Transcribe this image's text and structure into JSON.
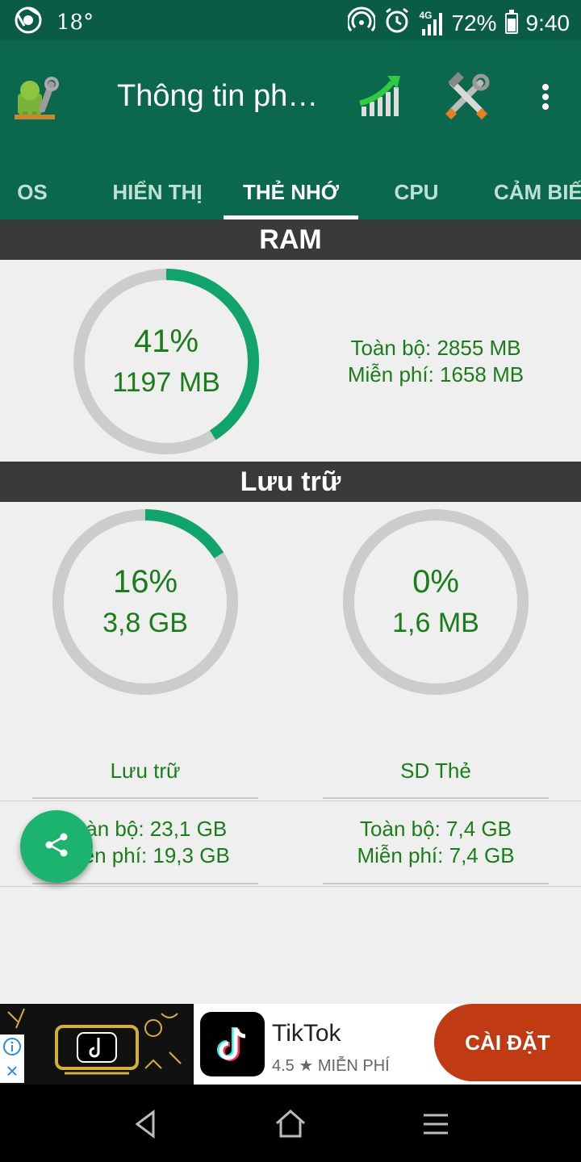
{
  "status_bar": {
    "temperature": "18°",
    "battery": "72%",
    "time": "9:40",
    "network": "4G"
  },
  "app_bar": {
    "title": "Thông tin ph…"
  },
  "tabs": [
    {
      "label": "OS",
      "active": false
    },
    {
      "label": "HIỂN THỊ",
      "active": false
    },
    {
      "label": "THẺ NHỚ",
      "active": true
    },
    {
      "label": "CPU",
      "active": false
    },
    {
      "label": "CẢM BIẾN",
      "active": false
    }
  ],
  "ram": {
    "header": "RAM",
    "percent_label": "41%",
    "percent_value": 0.41,
    "used": "1197 MB",
    "total": "Toàn bộ: 2855 MB",
    "free": "Miễn phí: 1658 MB"
  },
  "storage": {
    "header": "Lưu trữ",
    "internal": {
      "percent_label": "16%",
      "percent_value": 0.16,
      "used": "3,8 GB",
      "label": "Lưu trữ",
      "total": "Toàn bộ: 23,1 GB",
      "free": "Miễn phí: 19,3 GB"
    },
    "sd": {
      "percent_label": "0%",
      "percent_value": 0.0,
      "used": "1,6 MB",
      "label": "SD Thẻ",
      "total": "Toàn bộ: 7,4 GB",
      "free": "Miễn phí: 7,4 GB"
    }
  },
  "ad": {
    "app_name": "TikTok",
    "rating": "4.5 ★ MIỄN PHÍ",
    "install_label": "CÀI ĐẶT"
  },
  "colors": {
    "app_bar": "#0c684c",
    "status_bar": "#0a5c44",
    "ring_progress": "#10a36c",
    "ring_track": "#cccccc",
    "value_text": "#1a7d1a",
    "section_header": "#3a3a3a",
    "fab": "#1bb36e",
    "ad_button": "#c03a14"
  }
}
